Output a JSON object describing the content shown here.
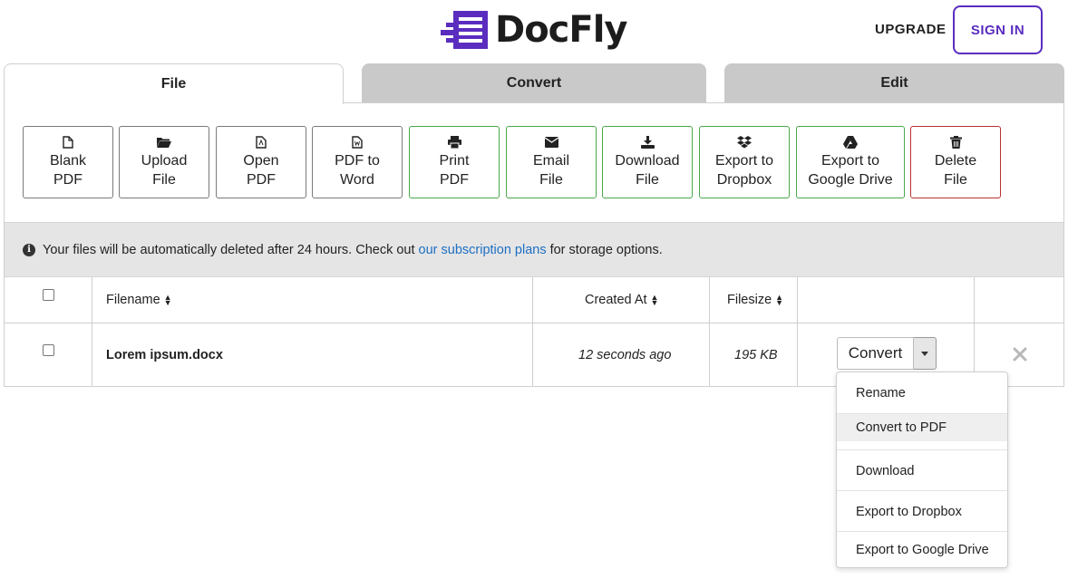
{
  "header": {
    "logo_text": "DocFly",
    "upgrade_label": "UPGRADE",
    "signin_label": "SIGN IN",
    "brand_color": "#5a2dbf"
  },
  "tabs": [
    {
      "label": "File",
      "active": true
    },
    {
      "label": "Convert",
      "active": false
    },
    {
      "label": "Edit",
      "active": false
    }
  ],
  "toolbar": {
    "blank_pdf": "Blank\nPDF",
    "upload_file": "Upload\nFile",
    "open_pdf": "Open\nPDF",
    "pdf_to_word": "PDF to\nWord",
    "print_pdf": "Print\nPDF",
    "email_file": "Email\nFile",
    "download_file": "Download\nFile",
    "export_dropbox": "Export to\nDropbox",
    "export_gdrive": "Export to\nGoogle Drive",
    "delete_file": "Delete\nFile"
  },
  "notice": {
    "before": "Your files will be automatically deleted after 24 hours. Check out",
    "link": "our subscription plans",
    "after": "for storage options."
  },
  "table": {
    "headers": {
      "filename": "Filename",
      "created_at": "Created At",
      "filesize": "Filesize"
    },
    "rows": [
      {
        "filename": "Lorem ipsum.docx",
        "created_at": "12 seconds ago",
        "filesize": "195 KB",
        "action_label": "Convert"
      }
    ]
  },
  "dropdown": {
    "items": [
      "Rename",
      "Convert to PDF",
      "Download",
      "Export to Dropbox",
      "Export to Google Drive"
    ],
    "highlighted": "Convert to PDF"
  }
}
